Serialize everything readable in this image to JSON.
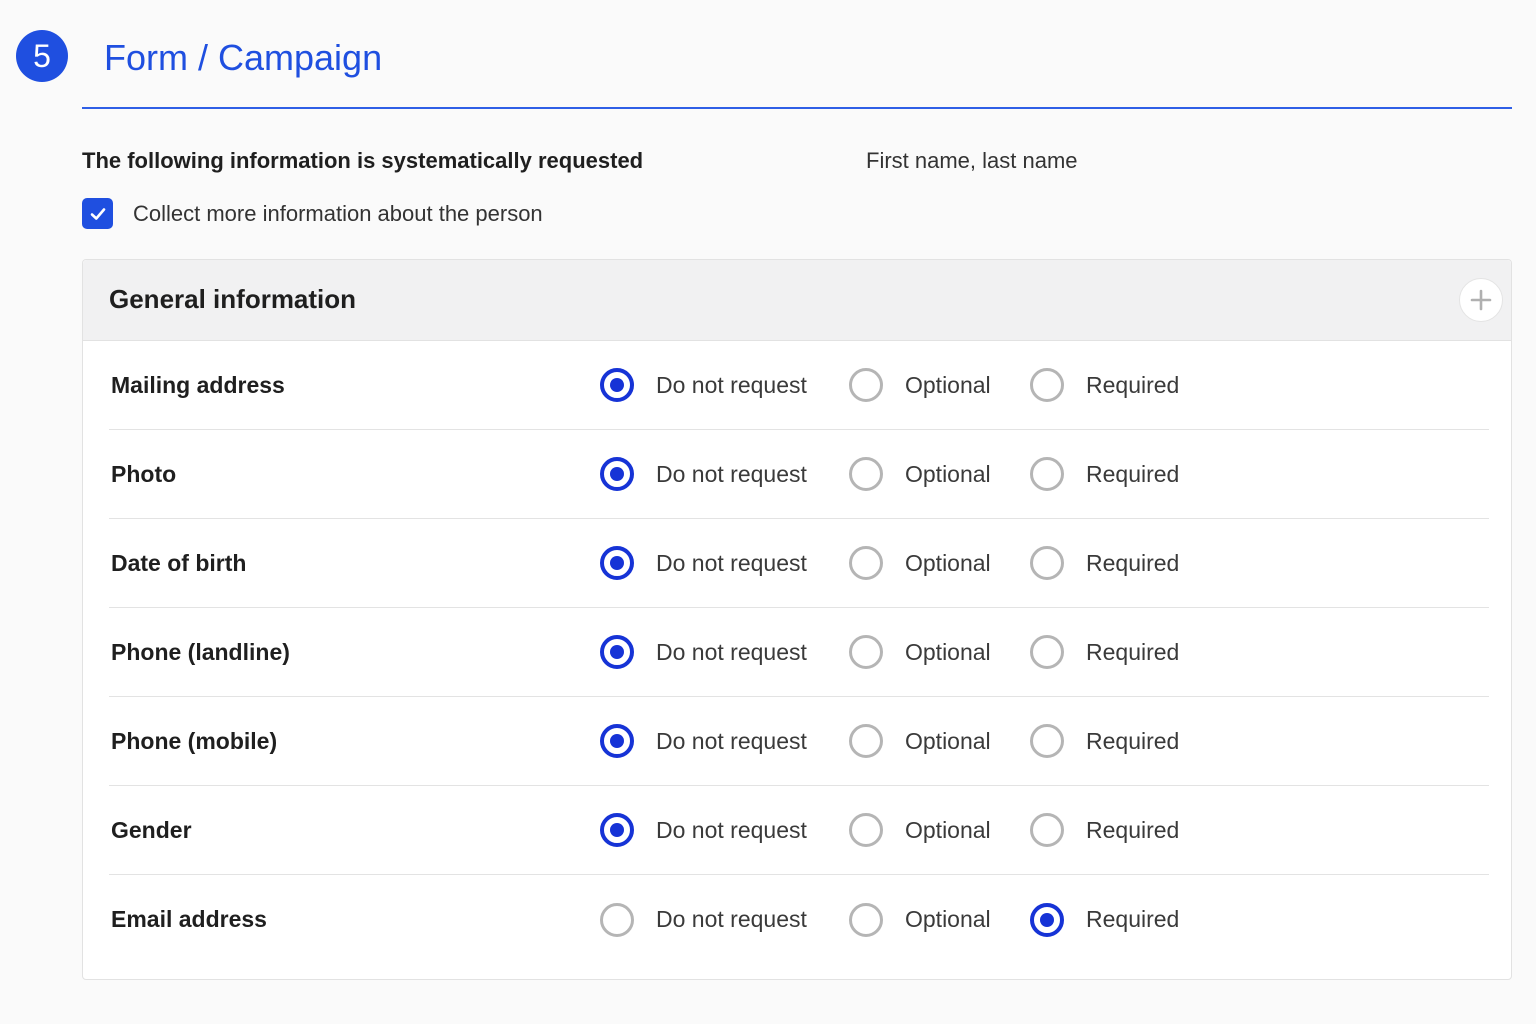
{
  "header": {
    "step_number": "5",
    "title": "Form / Campaign"
  },
  "systematic": {
    "label": "The following information is systematically requested",
    "value": "First name, last name"
  },
  "collect_more": {
    "label": "Collect more information about the person",
    "checked": true
  },
  "panel": {
    "title": "General information",
    "add_icon": "plus-icon",
    "option_labels": [
      "Do not request",
      "Optional",
      "Required"
    ],
    "fields": [
      {
        "label": "Mailing address",
        "selected": "Do not request"
      },
      {
        "label": "Photo",
        "selected": "Do not request"
      },
      {
        "label": "Date of birth",
        "selected": "Do not request"
      },
      {
        "label": "Phone (landline)",
        "selected": "Do not request"
      },
      {
        "label": "Phone (mobile)",
        "selected": "Do not request"
      },
      {
        "label": "Gender",
        "selected": "Do not request"
      },
      {
        "label": "Email address",
        "selected": "Required"
      }
    ]
  },
  "colors": {
    "accent": "#1f4fe0",
    "radio_selected": "#1633d6",
    "radio_unselected": "#b5b5b5"
  }
}
